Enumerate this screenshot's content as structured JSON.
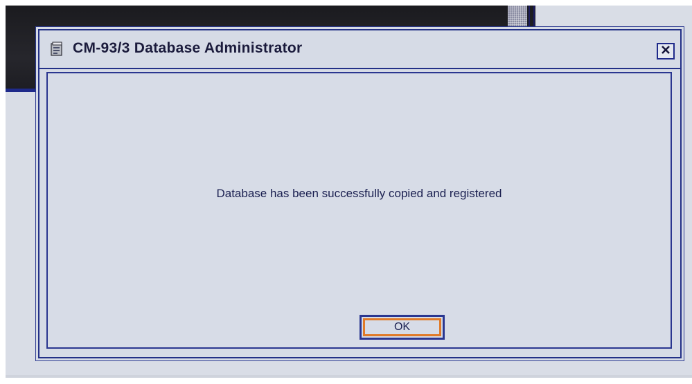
{
  "dialog": {
    "title": "CM-93/3 Database Administrator",
    "title_icon": "database-icon",
    "close_icon": "close-icon",
    "message": "Database has been successfully copied and registered",
    "ok_label": "OK"
  },
  "colors": {
    "dialog_background": "#d6dbe6",
    "border_blue": "#233087",
    "focus_orange": "#e07a28",
    "dark_background": "#1b1b1f"
  }
}
